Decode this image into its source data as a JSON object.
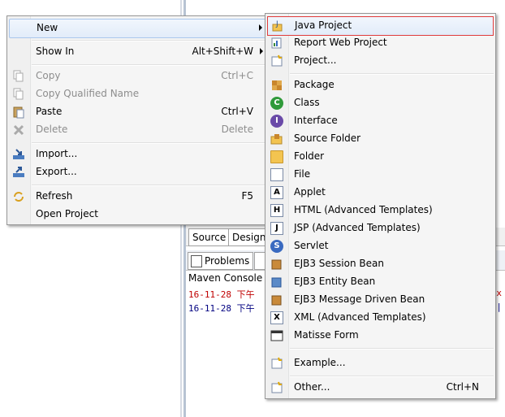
{
  "colors": {
    "highlight_border": "#e03b3b",
    "console_red": "#c00000",
    "console_blue": "#000080"
  },
  "editor": {
    "tab_source": "Source",
    "tab_design": "Design"
  },
  "bottom_panel": {
    "problems_tab": "Problems",
    "console_title": "Maven Console",
    "lines": [
      "16-11-28 下午",
      "16-11-28 下午"
    ],
    "edge_marks": [
      "x",
      "1|"
    ]
  },
  "context_menu": {
    "items": [
      {
        "label": "New",
        "shortcut": "",
        "submenu": true,
        "icon": ""
      },
      {
        "label": "Show In",
        "shortcut": "Alt+Shift+W",
        "submenu": true,
        "icon": ""
      },
      {
        "label": "Copy",
        "shortcut": "Ctrl+C",
        "disabled": true,
        "icon": "copy-icon"
      },
      {
        "label": "Copy Qualified Name",
        "shortcut": "",
        "disabled": true,
        "icon": "copy-qualified-icon"
      },
      {
        "label": "Paste",
        "shortcut": "Ctrl+V",
        "icon": "paste-icon"
      },
      {
        "label": "Delete",
        "shortcut": "Delete",
        "disabled": true,
        "icon": "delete-icon"
      },
      {
        "label": "Import...",
        "shortcut": "",
        "icon": "import-icon"
      },
      {
        "label": "Export...",
        "shortcut": "",
        "icon": "export-icon"
      },
      {
        "label": "Refresh",
        "shortcut": "F5",
        "icon": "refresh-icon"
      },
      {
        "label": "Open Project",
        "shortcut": "",
        "icon": ""
      }
    ]
  },
  "new_submenu": {
    "items": [
      {
        "label": "Java Project",
        "icon": "java-project-icon"
      },
      {
        "label": "Report Web Project",
        "icon": "report-web-project-icon"
      },
      {
        "label": "Project...",
        "icon": "project-icon"
      },
      {
        "label": "Package",
        "icon": "package-icon"
      },
      {
        "label": "Class",
        "icon": "class-icon"
      },
      {
        "label": "Interface",
        "icon": "interface-icon"
      },
      {
        "label": "Source Folder",
        "icon": "source-folder-icon"
      },
      {
        "label": "Folder",
        "icon": "folder-icon"
      },
      {
        "label": "File",
        "icon": "file-icon"
      },
      {
        "label": "Applet",
        "icon": "applet-icon"
      },
      {
        "label": "HTML (Advanced Templates)",
        "icon": "html-icon"
      },
      {
        "label": "JSP (Advanced Templates)",
        "icon": "jsp-icon"
      },
      {
        "label": "Servlet",
        "icon": "servlet-icon"
      },
      {
        "label": "EJB3 Session Bean",
        "icon": "ejb-session-icon"
      },
      {
        "label": "EJB3 Entity Bean",
        "icon": "ejb-entity-icon"
      },
      {
        "label": "EJB3 Message Driven Bean",
        "icon": "ejb-message-icon"
      },
      {
        "label": "XML (Advanced Templates)",
        "icon": "xml-icon"
      },
      {
        "label": "Matisse Form",
        "icon": "matisse-form-icon"
      },
      {
        "label": "Example...",
        "icon": "example-icon"
      },
      {
        "label": "Other...",
        "shortcut": "Ctrl+N",
        "icon": "other-icon"
      }
    ]
  }
}
